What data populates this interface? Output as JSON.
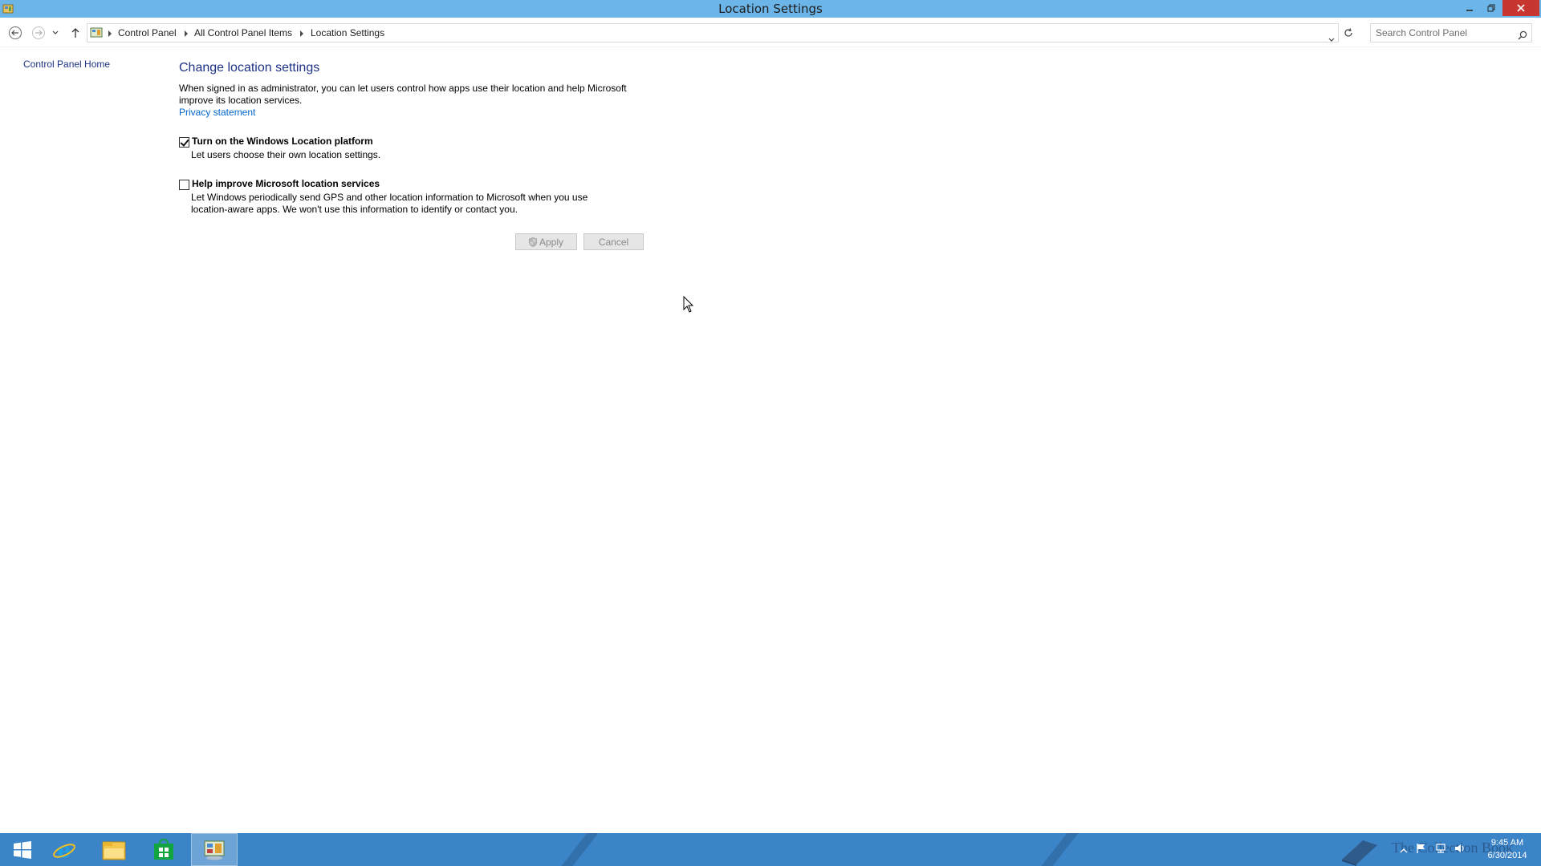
{
  "window": {
    "title": "Location Settings",
    "controls": {
      "minimize": "minimize",
      "maximize": "restore",
      "close": "close"
    }
  },
  "nav": {
    "breadcrumb": [
      "Control Panel",
      "All Control Panel Items",
      "Location Settings"
    ],
    "search_placeholder": "Search Control Panel"
  },
  "sidebar": {
    "home_link": "Control Panel Home"
  },
  "main": {
    "heading": "Change location settings",
    "description": "When signed in as administrator, you can let users control how apps use their location and help Microsoft improve its location services.",
    "privacy_link": "Privacy statement",
    "options": [
      {
        "label": "Turn on the Windows Location platform",
        "description": "Let users choose their own location settings.",
        "checked": true
      },
      {
        "label": "Help improve Microsoft location services",
        "description": "Let Windows periodically send GPS and other location information to Microsoft when you use location-aware apps. We won't use this information to identify or contact you.",
        "checked": false
      }
    ],
    "apply_label": "Apply",
    "cancel_label": "Cancel"
  },
  "taskbar": {
    "items": [
      "start-icon",
      "internet-explorer-icon",
      "file-explorer-icon",
      "store-icon",
      "control-panel-icon"
    ],
    "active_item": "control-panel-icon",
    "clock_time": "9:45 AM",
    "clock_date": "6/30/2014",
    "watermark": "The Collection Book"
  },
  "colors": {
    "titlebar": "#6cb5e9",
    "taskbar": "#3c84c8",
    "link": "#1e3287",
    "close_button": "#c7372f"
  }
}
